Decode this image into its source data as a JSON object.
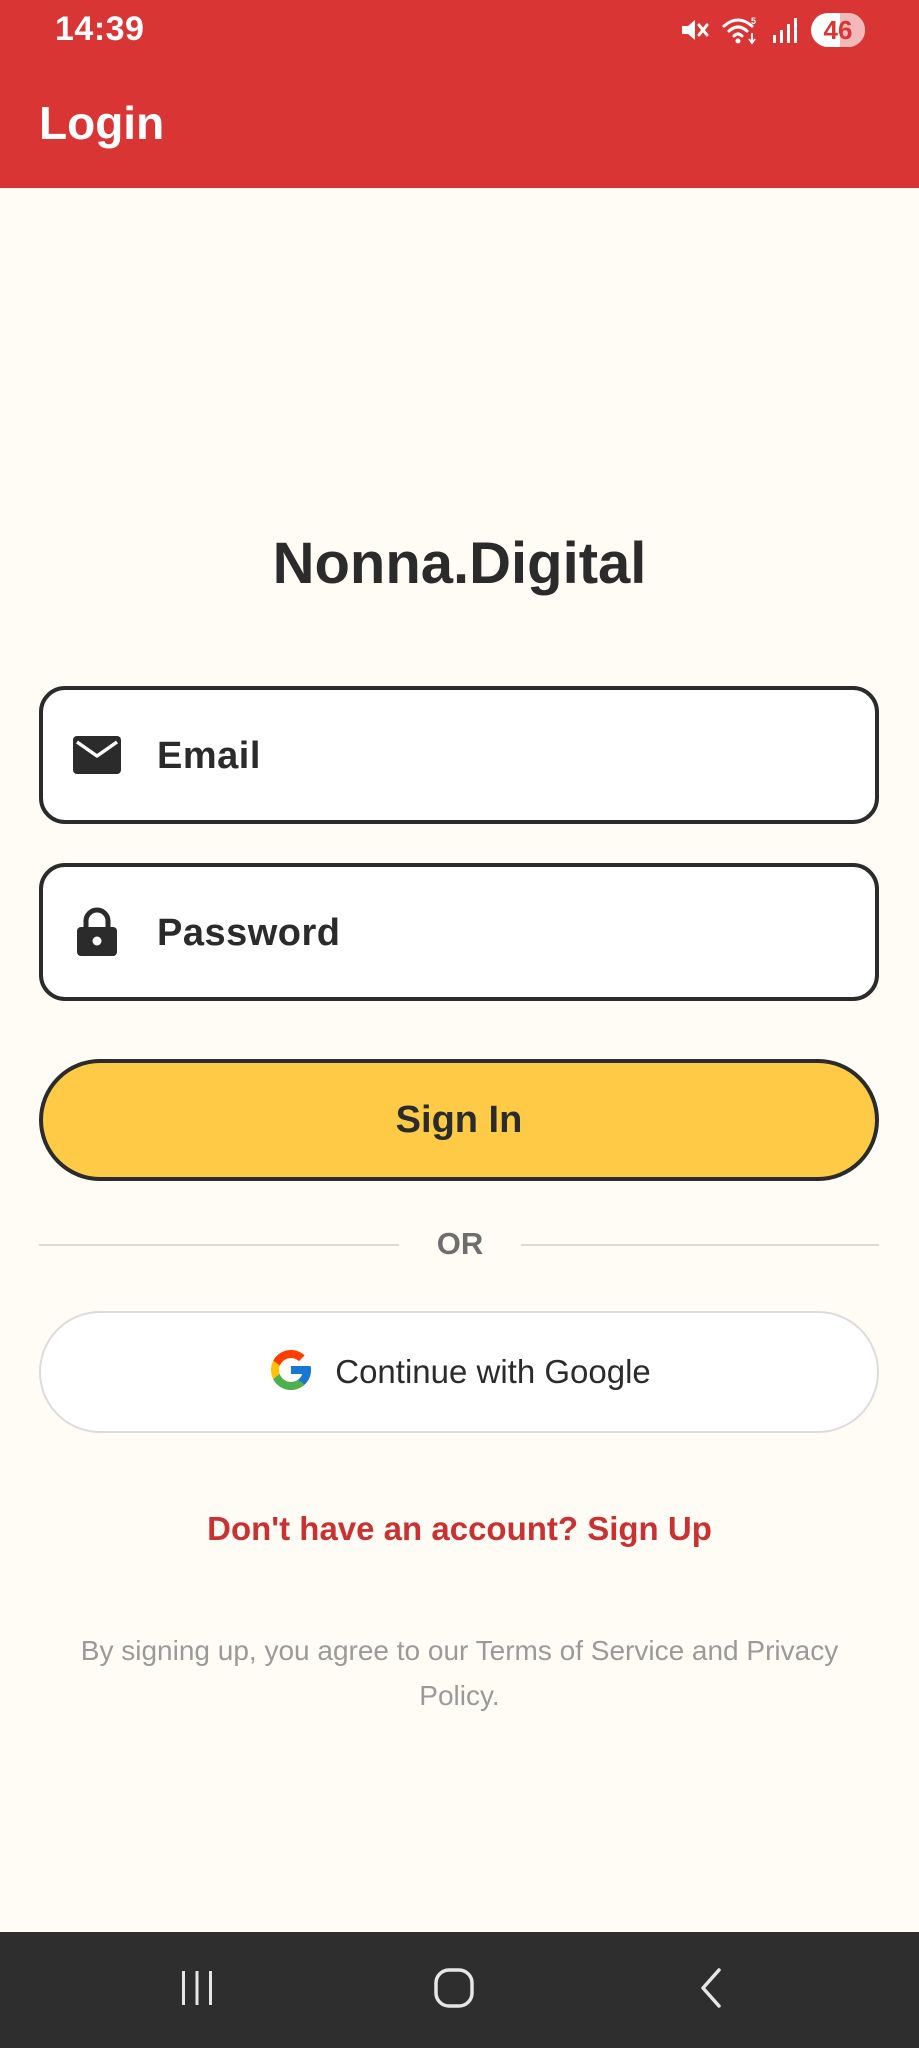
{
  "status_bar": {
    "time": "14:39",
    "battery": "46",
    "icons": [
      "mute-icon",
      "wifi-icon",
      "signal-icon",
      "battery-icon"
    ]
  },
  "app_bar": {
    "title": "Login"
  },
  "brand": {
    "name": "Nonna.Digital"
  },
  "form": {
    "email": {
      "placeholder": "Email",
      "value": "",
      "icon": "mail-icon"
    },
    "password": {
      "placeholder": "Password",
      "value": "",
      "icon": "lock-icon"
    },
    "sign_in_label": "Sign In",
    "divider_label": "OR",
    "google_label": "Continue with Google",
    "google_icon": "google-logo-icon"
  },
  "links": {
    "signup": "Don't have an account? Sign Up"
  },
  "footer": {
    "terms": "By signing up, you agree to our Terms of Service and Privacy Policy."
  },
  "nav_bar": {
    "icons": [
      "recents-icon",
      "home-icon",
      "back-icon"
    ]
  },
  "colors": {
    "primary": "#d93535",
    "background": "#fffcf5",
    "accent": "#ffcb47",
    "text": "#2b2b2b",
    "link": "#c83232",
    "muted": "#9a9a9a",
    "navbar": "#2e2e2e"
  }
}
